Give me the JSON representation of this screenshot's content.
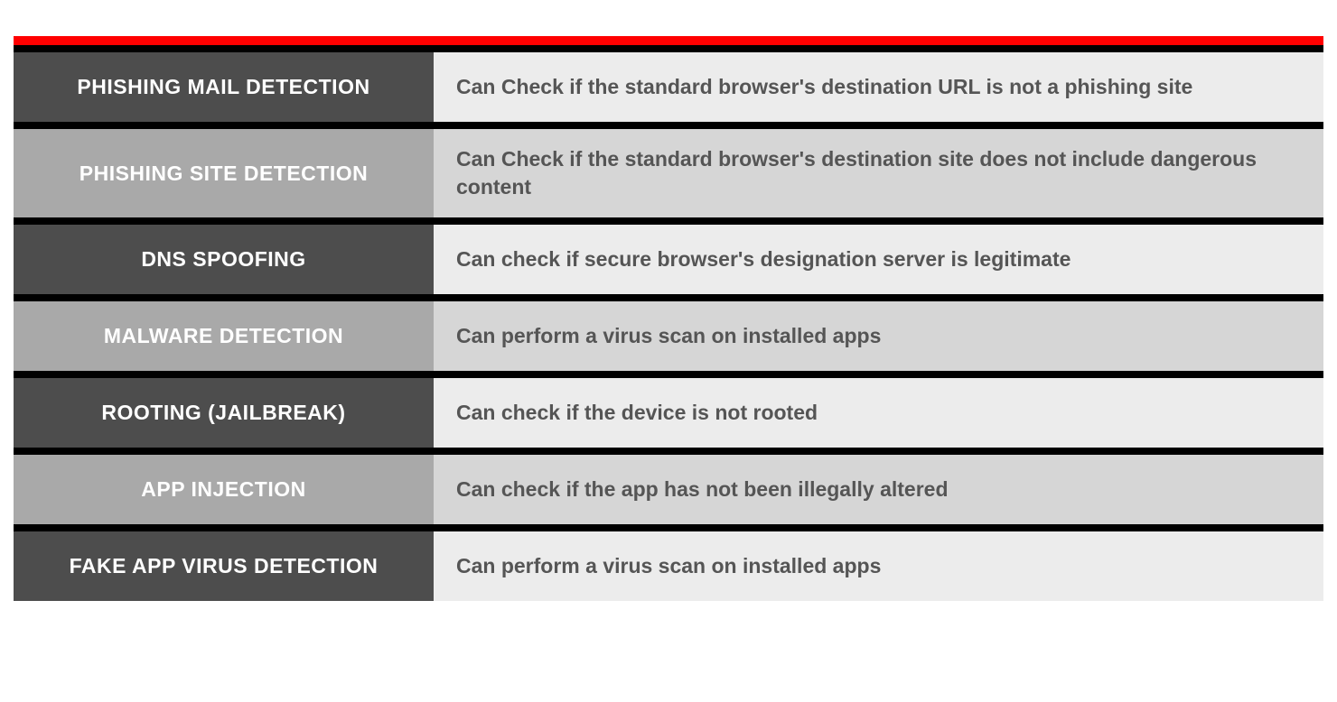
{
  "rows": [
    {
      "label": "PHISHING MAIL DETECTION",
      "desc": "Can Check if the standard browser's destination URL is not a phishing site"
    },
    {
      "label": "PHISHING SITE DETECTION",
      "desc": "Can Check if the standard browser's destination site does not include dangerous content"
    },
    {
      "label": "DNS SPOOFING",
      "desc": "Can check if secure browser's designation server is legitimate"
    },
    {
      "label": "MALWARE DETECTION",
      "desc": "Can perform a virus scan on installed apps"
    },
    {
      "label": "ROOTING (JAILBREAK)",
      "desc": "Can check if the device is not rooted"
    },
    {
      "label": "APP INJECTION",
      "desc": "Can check if the app has not been illegally altered"
    },
    {
      "label": "FAKE APP VIRUS DETECTION",
      "desc": "Can perform a virus scan on installed apps"
    }
  ]
}
